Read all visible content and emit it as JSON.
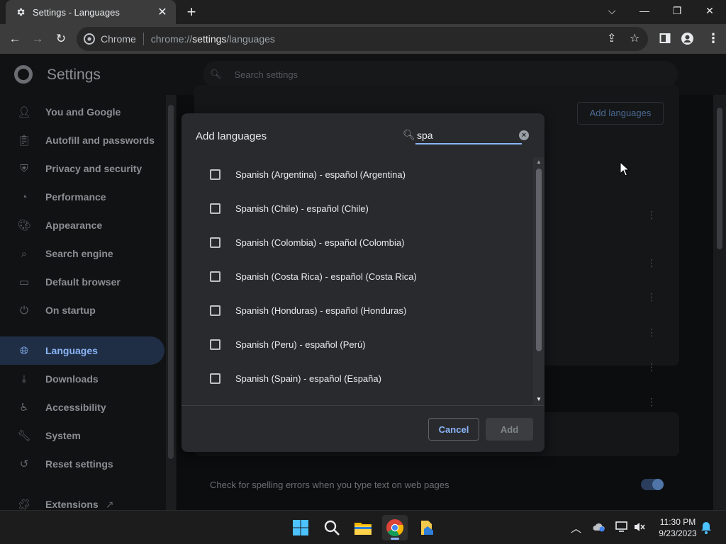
{
  "browser": {
    "tab_title": "Settings - Languages",
    "omnibox_chip": "Chrome",
    "url_scheme": "chrome://",
    "url_host": "settings",
    "url_path": "/languages"
  },
  "settings": {
    "title": "Settings",
    "search_placeholder": "Search settings",
    "nav": [
      {
        "label": "You and Google",
        "icon": "person-icon"
      },
      {
        "label": "Autofill and passwords",
        "icon": "clipboard-icon"
      },
      {
        "label": "Privacy and security",
        "icon": "shield-icon"
      },
      {
        "label": "Performance",
        "icon": "speedometer-icon"
      },
      {
        "label": "Appearance",
        "icon": "palette-icon"
      },
      {
        "label": "Search engine",
        "icon": "search-icon"
      },
      {
        "label": "Default browser",
        "icon": "browser-window-icon"
      },
      {
        "label": "On startup",
        "icon": "power-icon"
      },
      {
        "label": "Languages",
        "icon": "globe-icon",
        "active": true
      },
      {
        "label": "Downloads",
        "icon": "download-icon"
      },
      {
        "label": "Accessibility",
        "icon": "accessibility-icon"
      },
      {
        "label": "System",
        "icon": "wrench-icon"
      },
      {
        "label": "Reset settings",
        "icon": "history-icon"
      },
      {
        "label": "Extensions",
        "icon": "puzzle-icon"
      }
    ],
    "add_languages_label": "Add languages",
    "spell_check_label": "Check for spelling errors when you type text on web pages",
    "spell_check_on": true
  },
  "dialog": {
    "title": "Add languages",
    "search_value": "spa",
    "languages": [
      {
        "label": "Spanish (Argentina) - español (Argentina)",
        "checked": false
      },
      {
        "label": "Spanish (Chile) - español (Chile)",
        "checked": false
      },
      {
        "label": "Spanish (Colombia) - español (Colombia)",
        "checked": false
      },
      {
        "label": "Spanish (Costa Rica) - español (Costa Rica)",
        "checked": false
      },
      {
        "label": "Spanish (Honduras) - español (Honduras)",
        "checked": false
      },
      {
        "label": "Spanish (Peru) - español (Perú)",
        "checked": false
      },
      {
        "label": "Spanish (Spain) - español (España)",
        "checked": false
      }
    ],
    "cancel_label": "Cancel",
    "add_label": "Add"
  },
  "taskbar": {
    "time": "11:30 PM",
    "date": "9/23/2023"
  },
  "colors": {
    "accent": "#8ab4f8",
    "dialog_bg": "#292a2d",
    "active_nav_bg": "#1f2e44"
  }
}
